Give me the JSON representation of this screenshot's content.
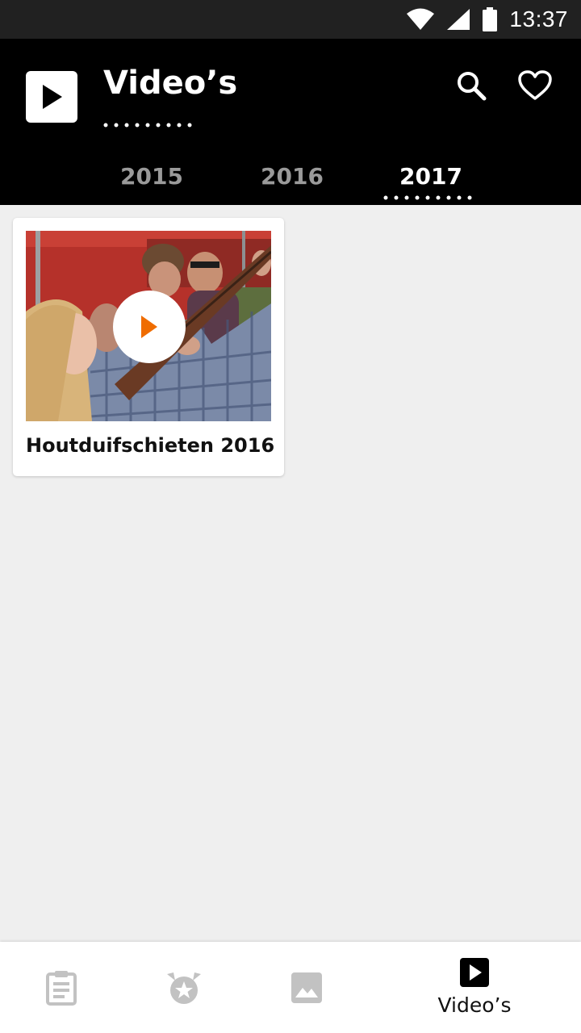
{
  "status_bar": {
    "time": "13:37",
    "icons": [
      "wifi-icon",
      "cell-signal-icon",
      "battery-icon"
    ]
  },
  "header": {
    "title": "Video’s",
    "logo_icon": "play-icon",
    "actions": [
      {
        "icon": "search-icon"
      },
      {
        "icon": "heart-icon"
      }
    ]
  },
  "tabs": [
    {
      "label": "2015",
      "active": false
    },
    {
      "label": "2016",
      "active": false
    },
    {
      "label": "2017",
      "active": true
    }
  ],
  "videos": [
    {
      "title": "Houtduifschieten 2016",
      "play_icon": "play-circle-icon"
    }
  ],
  "bottom_nav": [
    {
      "icon": "clipboard-icon",
      "label": ""
    },
    {
      "icon": "star-badge-icon",
      "label": ""
    },
    {
      "icon": "image-icon",
      "label": ""
    },
    {
      "icon": "video-play-icon",
      "label": "Video’s",
      "active": true
    }
  ],
  "colors": {
    "accent": "#ef6c00",
    "header_bg": "#000000",
    "status_bg": "#212121",
    "background": "#efefef",
    "inactive_tab": "#9a9a9a",
    "inactive_icon": "#c2c2c2"
  }
}
